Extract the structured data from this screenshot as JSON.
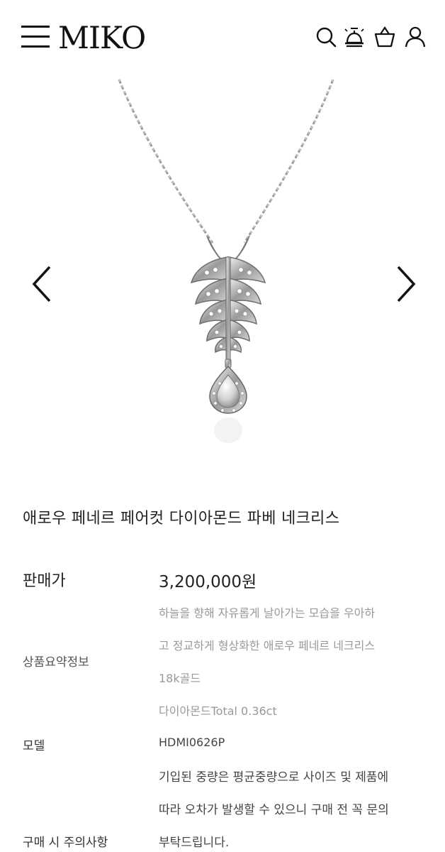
{
  "header": {
    "logo": "MIKO",
    "icons": [
      "menu-icon",
      "search-icon",
      "bell-icon",
      "basket-icon",
      "user-icon"
    ]
  },
  "gallery": {
    "prev_icon": "chevron-left-icon",
    "next_icon": "chevron-right-icon"
  },
  "product": {
    "title": "애로우 페네르 페어컷 다이아몬드 파베 네크리스",
    "price_label": "판매가",
    "price_value": "3,200,000원",
    "summary_label": "상품요약정보",
    "summary_lines": [
      "하늘을 향해 자유롭게 날아가는 모습을 우아하",
      "고 정교하게 형상화한 애로우 페네르 네크리스",
      "18k골드",
      "다이아몬드Total 0.36ct"
    ],
    "model_label": "모델",
    "model_value": "HDMI0626P",
    "caution_label": "구매 시 주의사항",
    "caution_lines": [
      "기입된 중량은 평균중량으로 사이즈 및 제품에",
      "따라 오차가 발생할 수 있으니 구매 전 꼭 문의",
      "부탁드립니다."
    ]
  }
}
